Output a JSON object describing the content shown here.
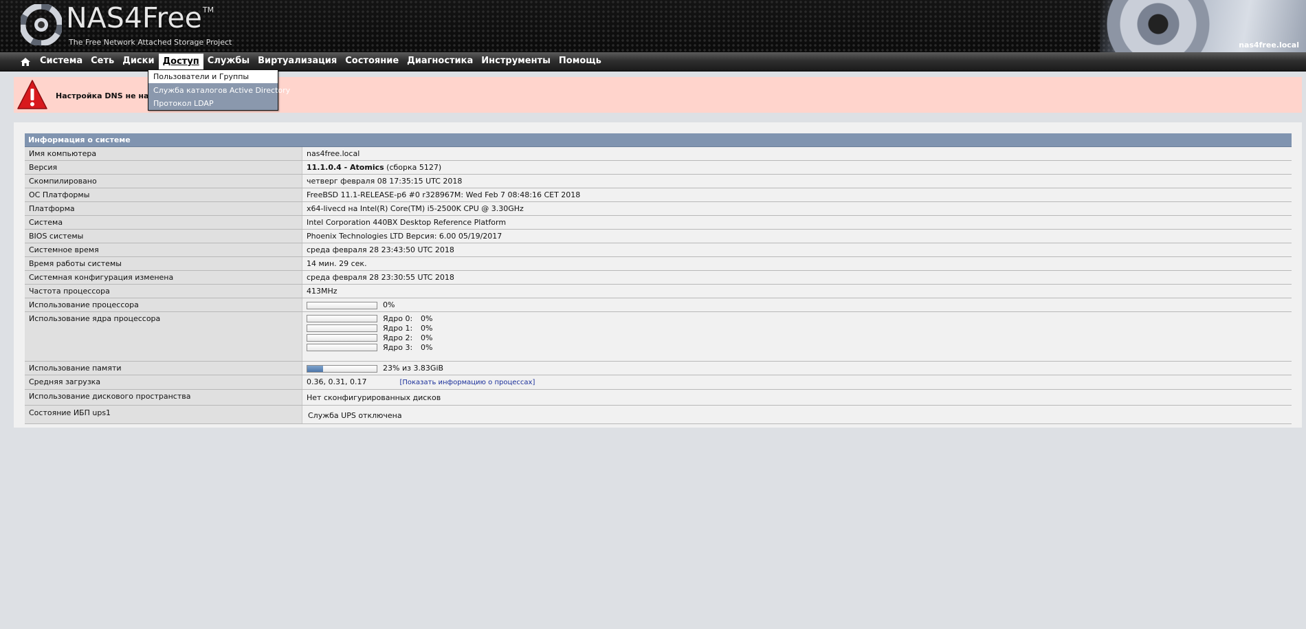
{
  "header": {
    "logo_text": "NAS4Free",
    "logo_tm": "TM",
    "tagline": "The Free Network Attached Storage Project",
    "hostname": "nas4free.local"
  },
  "nav": {
    "items": [
      "Система",
      "Сеть",
      "Диски",
      "Доступ",
      "Службы",
      "Виртуализация",
      "Состояние",
      "Диагностика",
      "Инструменты",
      "Помощь"
    ],
    "active": "Доступ"
  },
  "dropdown": {
    "items": [
      "Пользователи и Группы",
      "Служба каталогов Active Directory",
      "Протокол LDAP"
    ]
  },
  "alert": {
    "message": "Настройка DNS не найд"
  },
  "system_info": {
    "title": "Информация о системе",
    "rows": [
      {
        "label": "Имя компьютера",
        "value": "nas4free.local"
      },
      {
        "label": "Версия",
        "version_bold": "11.1.0.4 - Atomics",
        "version_rest": " (сборка 5127)"
      },
      {
        "label": "Скомпилировано",
        "value": "четверг февраля 08 17:35:15 UTC 2018"
      },
      {
        "label": "ОС Платформы",
        "value": "FreeBSD 11.1-RELEASE-p6 #0 r328967M: Wed Feb 7 08:48:16 CET 2018"
      },
      {
        "label": "Платформа",
        "value": "x64-livecd на Intel(R) Core(TM) i5-2500K CPU @ 3.30GHz"
      },
      {
        "label": "Система",
        "value": "Intel Corporation 440BX Desktop Reference Platform"
      },
      {
        "label": "BIOS системы",
        "value": "Phoenix Technologies LTD Версия: 6.00 05/19/2017"
      },
      {
        "label": "Системное время",
        "value": "среда февраля 28 23:43:50 UTC 2018"
      },
      {
        "label": "Время работы системы",
        "value": "14 мин. 29 сек."
      },
      {
        "label": "Системная конфигурация изменена",
        "value": "среда февраля 28 23:30:55 UTC 2018"
      },
      {
        "label": "Частота процессора",
        "value": "413MHz"
      }
    ],
    "cpu_usage": {
      "label": "Использование процессора",
      "value": "0%",
      "fraction": 0.0
    },
    "core_usage": {
      "label": "Использование ядра процессора",
      "cores": [
        {
          "name": "Ядро 0:",
          "value": "0%",
          "fraction": 0.0
        },
        {
          "name": "Ядро 1:",
          "value": "0%",
          "fraction": 0.0
        },
        {
          "name": "Ядро 2:",
          "value": "0%",
          "fraction": 0.0
        },
        {
          "name": "Ядро 3:",
          "value": "0%",
          "fraction": 0.0
        }
      ]
    },
    "memory_usage": {
      "label": "Использование памяти",
      "value": "23% из 3.83GiB",
      "fraction": 0.23
    },
    "load_average": {
      "label": "Средняя загрузка",
      "value": "0.36, 0.31, 0.17",
      "link": "Показать информацию о процессах"
    },
    "disk_usage": {
      "label": "Использование дискового пространства",
      "value": "Нет сконфигурированных дисков"
    },
    "ups": {
      "label": "Состояние ИБП ups1",
      "value": "Служба UPS отключена"
    }
  }
}
